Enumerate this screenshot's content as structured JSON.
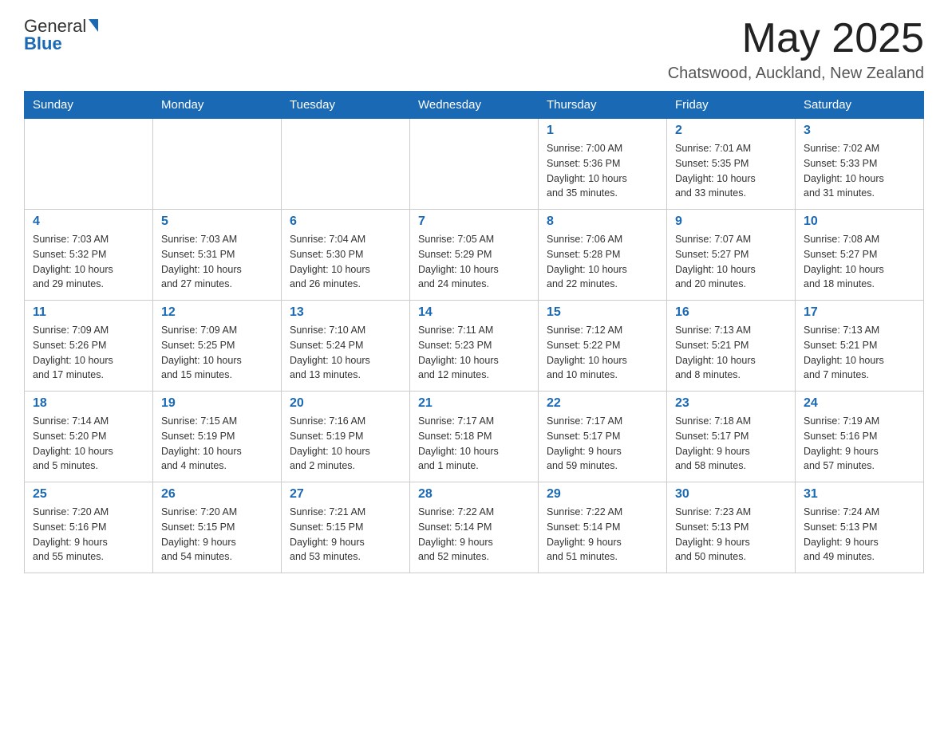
{
  "header": {
    "logo_line1": "General",
    "logo_line2": "Blue",
    "month_title": "May 2025",
    "location": "Chatswood, Auckland, New Zealand"
  },
  "days_of_week": [
    "Sunday",
    "Monday",
    "Tuesday",
    "Wednesday",
    "Thursday",
    "Friday",
    "Saturday"
  ],
  "weeks": [
    [
      {
        "day": "",
        "info": ""
      },
      {
        "day": "",
        "info": ""
      },
      {
        "day": "",
        "info": ""
      },
      {
        "day": "",
        "info": ""
      },
      {
        "day": "1",
        "info": "Sunrise: 7:00 AM\nSunset: 5:36 PM\nDaylight: 10 hours\nand 35 minutes."
      },
      {
        "day": "2",
        "info": "Sunrise: 7:01 AM\nSunset: 5:35 PM\nDaylight: 10 hours\nand 33 minutes."
      },
      {
        "day": "3",
        "info": "Sunrise: 7:02 AM\nSunset: 5:33 PM\nDaylight: 10 hours\nand 31 minutes."
      }
    ],
    [
      {
        "day": "4",
        "info": "Sunrise: 7:03 AM\nSunset: 5:32 PM\nDaylight: 10 hours\nand 29 minutes."
      },
      {
        "day": "5",
        "info": "Sunrise: 7:03 AM\nSunset: 5:31 PM\nDaylight: 10 hours\nand 27 minutes."
      },
      {
        "day": "6",
        "info": "Sunrise: 7:04 AM\nSunset: 5:30 PM\nDaylight: 10 hours\nand 26 minutes."
      },
      {
        "day": "7",
        "info": "Sunrise: 7:05 AM\nSunset: 5:29 PM\nDaylight: 10 hours\nand 24 minutes."
      },
      {
        "day": "8",
        "info": "Sunrise: 7:06 AM\nSunset: 5:28 PM\nDaylight: 10 hours\nand 22 minutes."
      },
      {
        "day": "9",
        "info": "Sunrise: 7:07 AM\nSunset: 5:27 PM\nDaylight: 10 hours\nand 20 minutes."
      },
      {
        "day": "10",
        "info": "Sunrise: 7:08 AM\nSunset: 5:27 PM\nDaylight: 10 hours\nand 18 minutes."
      }
    ],
    [
      {
        "day": "11",
        "info": "Sunrise: 7:09 AM\nSunset: 5:26 PM\nDaylight: 10 hours\nand 17 minutes."
      },
      {
        "day": "12",
        "info": "Sunrise: 7:09 AM\nSunset: 5:25 PM\nDaylight: 10 hours\nand 15 minutes."
      },
      {
        "day": "13",
        "info": "Sunrise: 7:10 AM\nSunset: 5:24 PM\nDaylight: 10 hours\nand 13 minutes."
      },
      {
        "day": "14",
        "info": "Sunrise: 7:11 AM\nSunset: 5:23 PM\nDaylight: 10 hours\nand 12 minutes."
      },
      {
        "day": "15",
        "info": "Sunrise: 7:12 AM\nSunset: 5:22 PM\nDaylight: 10 hours\nand 10 minutes."
      },
      {
        "day": "16",
        "info": "Sunrise: 7:13 AM\nSunset: 5:21 PM\nDaylight: 10 hours\nand 8 minutes."
      },
      {
        "day": "17",
        "info": "Sunrise: 7:13 AM\nSunset: 5:21 PM\nDaylight: 10 hours\nand 7 minutes."
      }
    ],
    [
      {
        "day": "18",
        "info": "Sunrise: 7:14 AM\nSunset: 5:20 PM\nDaylight: 10 hours\nand 5 minutes."
      },
      {
        "day": "19",
        "info": "Sunrise: 7:15 AM\nSunset: 5:19 PM\nDaylight: 10 hours\nand 4 minutes."
      },
      {
        "day": "20",
        "info": "Sunrise: 7:16 AM\nSunset: 5:19 PM\nDaylight: 10 hours\nand 2 minutes."
      },
      {
        "day": "21",
        "info": "Sunrise: 7:17 AM\nSunset: 5:18 PM\nDaylight: 10 hours\nand 1 minute."
      },
      {
        "day": "22",
        "info": "Sunrise: 7:17 AM\nSunset: 5:17 PM\nDaylight: 9 hours\nand 59 minutes."
      },
      {
        "day": "23",
        "info": "Sunrise: 7:18 AM\nSunset: 5:17 PM\nDaylight: 9 hours\nand 58 minutes."
      },
      {
        "day": "24",
        "info": "Sunrise: 7:19 AM\nSunset: 5:16 PM\nDaylight: 9 hours\nand 57 minutes."
      }
    ],
    [
      {
        "day": "25",
        "info": "Sunrise: 7:20 AM\nSunset: 5:16 PM\nDaylight: 9 hours\nand 55 minutes."
      },
      {
        "day": "26",
        "info": "Sunrise: 7:20 AM\nSunset: 5:15 PM\nDaylight: 9 hours\nand 54 minutes."
      },
      {
        "day": "27",
        "info": "Sunrise: 7:21 AM\nSunset: 5:15 PM\nDaylight: 9 hours\nand 53 minutes."
      },
      {
        "day": "28",
        "info": "Sunrise: 7:22 AM\nSunset: 5:14 PM\nDaylight: 9 hours\nand 52 minutes."
      },
      {
        "day": "29",
        "info": "Sunrise: 7:22 AM\nSunset: 5:14 PM\nDaylight: 9 hours\nand 51 minutes."
      },
      {
        "day": "30",
        "info": "Sunrise: 7:23 AM\nSunset: 5:13 PM\nDaylight: 9 hours\nand 50 minutes."
      },
      {
        "day": "31",
        "info": "Sunrise: 7:24 AM\nSunset: 5:13 PM\nDaylight: 9 hours\nand 49 minutes."
      }
    ]
  ]
}
